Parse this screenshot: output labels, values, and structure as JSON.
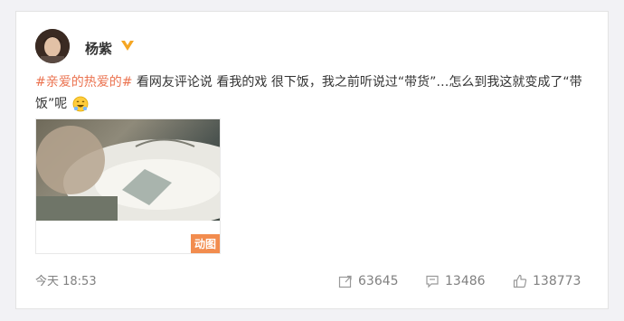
{
  "post": {
    "username": "杨紫",
    "hashtag": "#亲爱的热爱的#",
    "text": "看网友评论说 看我的戏 很下饭，我之前听说过“带货”…怎么到我这就变成了“带饭”呢",
    "media_badge": "动图",
    "timestamp": "今天 18:53"
  },
  "actions": {
    "forward_count": "63645",
    "comment_count": "13486",
    "like_count": "138773"
  },
  "icons": {
    "verify": "verified-badge-icon",
    "emoji": "grinning-emoji-icon",
    "forward": "forward-icon",
    "comment": "comment-icon",
    "like": "thumbs-up-icon"
  },
  "colors": {
    "hashtag": "#eb7350",
    "badge": "#f28c4e",
    "verify": "#f5a623"
  }
}
